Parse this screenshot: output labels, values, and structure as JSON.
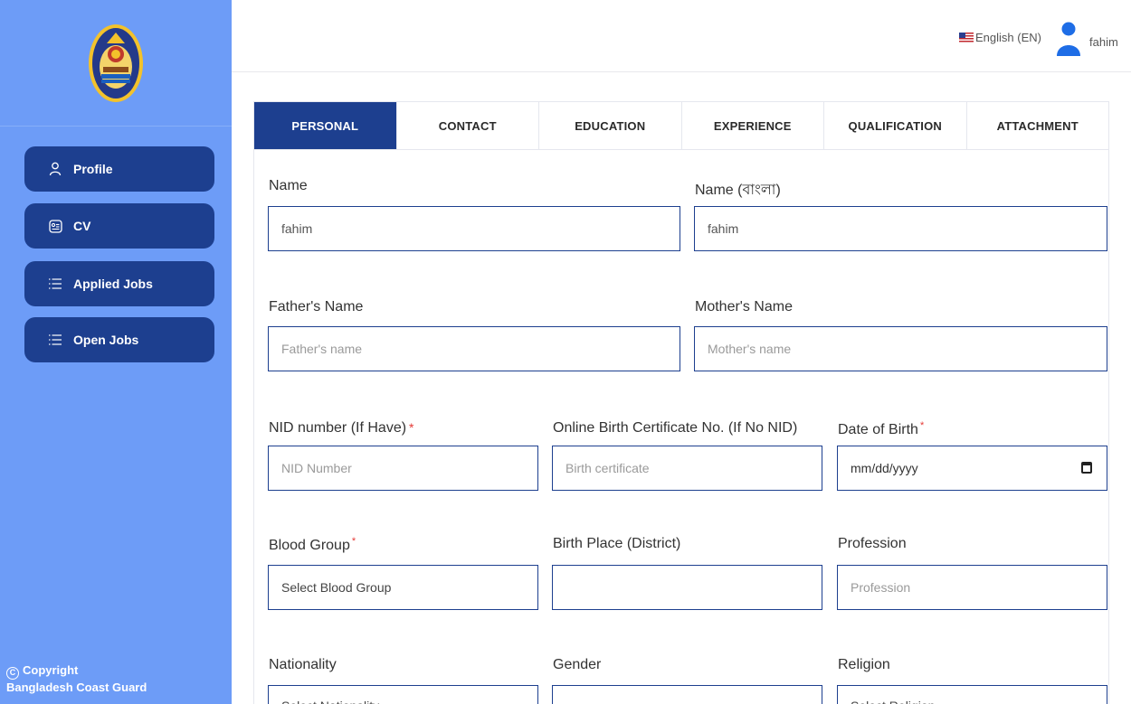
{
  "sidebar": {
    "logo": "bangladesh-coast-guard-emblem",
    "items": [
      {
        "label": "Profile",
        "icon": "person-icon"
      },
      {
        "label": "CV",
        "icon": "id-card-icon"
      },
      {
        "label": "Applied Jobs",
        "icon": "list-icon"
      },
      {
        "label": "Open Jobs",
        "icon": "list-icon"
      }
    ],
    "copyright_line1": "Copyright",
    "copyright_line2": "Bangladesh Coast Guard",
    "copyright_symbol": "C"
  },
  "header": {
    "language": "English (EN)",
    "user_name": "fahim"
  },
  "tabs": [
    "PERSONAL",
    "CONTACT",
    "EDUCATION",
    "EXPERIENCE",
    "QUALIFICATION",
    "ATTACHMENT"
  ],
  "active_tab": "PERSONAL",
  "form": {
    "name": {
      "label": "Name",
      "value": "fahim"
    },
    "name_bn": {
      "label": "Name (বাংলা)",
      "value": "fahim"
    },
    "father": {
      "label": "Father's Name",
      "placeholder": "Father's name"
    },
    "mother": {
      "label": "Mother's Name",
      "placeholder": "Mother's name"
    },
    "nid": {
      "label": "NID number (If Have)",
      "required_mark": "*",
      "placeholder": "NID Number"
    },
    "birth_cert": {
      "label": "Online Birth Certificate No. (If No NID)",
      "placeholder": "Birth certificate"
    },
    "dob": {
      "label": "Date of Birth",
      "required_mark": "*",
      "placeholder": "mm/dd/yyyy"
    },
    "blood": {
      "label": "Blood Group",
      "required_mark": "*",
      "value": "Select Blood Group"
    },
    "birth_place": {
      "label": "Birth Place (District)",
      "value": ""
    },
    "profession": {
      "label": "Profession",
      "placeholder": "Profession"
    },
    "nationality": {
      "label": "Nationality",
      "value": "Select Nationality"
    },
    "gender": {
      "label": "Gender",
      "value": ""
    },
    "religion": {
      "label": "Religion",
      "value": "Select Religion"
    }
  },
  "colors": {
    "sidebar_bg": "#6d9cf7",
    "primary": "#1d3f8f",
    "required": "#e53935"
  }
}
